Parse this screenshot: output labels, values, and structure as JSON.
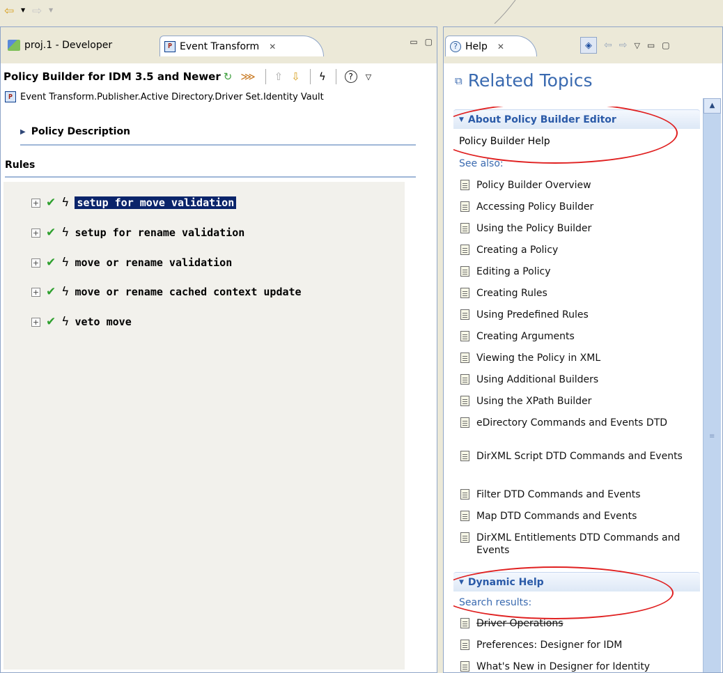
{
  "toolbar": {
    "back_icon": "back-arrow-icon",
    "forward_icon": "forward-arrow-icon"
  },
  "left_pane": {
    "tabs": [
      {
        "label": "proj.1 - Developer",
        "icon": "developer-perspective-icon"
      },
      {
        "label": "Event Transform",
        "icon": "policy-icon",
        "active": true
      }
    ],
    "editor_title": "Policy Builder for IDM 3.5 and Newer",
    "breadcrumb": "Event Transform.Publisher.Active Directory.Driver Set.Identity Vault",
    "policy_description_label": "Policy Description",
    "rules_heading": "Rules",
    "rules": [
      {
        "label": "setup for move validation",
        "selected": true
      },
      {
        "label": "setup for rename validation",
        "selected": false
      },
      {
        "label": "move or rename validation",
        "selected": false
      },
      {
        "label": "move or rename cached context update",
        "selected": false
      },
      {
        "label": "veto move",
        "selected": false
      }
    ]
  },
  "right_pane": {
    "tab_label": "Help",
    "related_topics_title": "Related Topics",
    "about_section": {
      "header": "About Policy Builder Editor",
      "help_line": "Policy Builder Help",
      "see_also": "See also:",
      "topics": [
        "Policy Builder Overview",
        "Accessing Policy Builder",
        "Using the Policy Builder",
        "Creating a Policy",
        "Editing a Policy",
        "Creating Rules",
        "Using Predefined Rules",
        "Creating Arguments",
        "Viewing the Policy in XML",
        "Using Additional Builders",
        "Using the XPath Builder",
        "eDirectory Commands and Events DTD",
        "DirXML Script DTD Commands and Events",
        "Filter DTD Commands and Events",
        "Map DTD Commands and Events",
        "DirXML Entitlements DTD Commands and Events"
      ]
    },
    "dynamic_section": {
      "header": "Dynamic Help",
      "search_results": "Search results:",
      "topics": [
        "Driver Operations",
        "Preferences: Designer for IDM",
        "What's New in Designer for Identity"
      ]
    }
  },
  "colors": {
    "accent_blue": "#3a6ab0",
    "selection": "#0a246a",
    "annotation_red": "#e02020",
    "check_green": "#2ea02e"
  }
}
